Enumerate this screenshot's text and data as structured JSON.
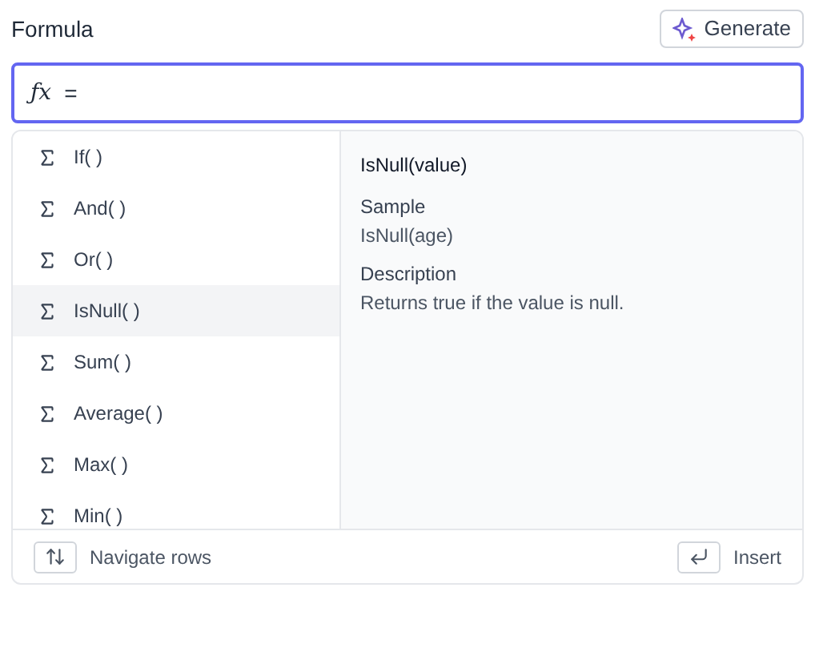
{
  "label": "Formula",
  "generate_button": {
    "label": "Generate"
  },
  "formula_field": {
    "prefix": "ƒx",
    "value": "="
  },
  "functions": [
    {
      "name": "If( )",
      "selected": false
    },
    {
      "name": "And( )",
      "selected": false
    },
    {
      "name": "Or( )",
      "selected": false
    },
    {
      "name": "IsNull( )",
      "selected": true
    },
    {
      "name": "Sum( )",
      "selected": false
    },
    {
      "name": "Average( )",
      "selected": false
    },
    {
      "name": "Max( )",
      "selected": false
    },
    {
      "name": "Min( )",
      "selected": false
    }
  ],
  "details": {
    "signature": "IsNull(value)",
    "sample_label": "Sample",
    "sample": "IsNull(age)",
    "description_label": "Description",
    "description": "Returns true if the value is null."
  },
  "footer": {
    "navigate_hint": "Navigate rows",
    "insert_hint": "Insert"
  }
}
